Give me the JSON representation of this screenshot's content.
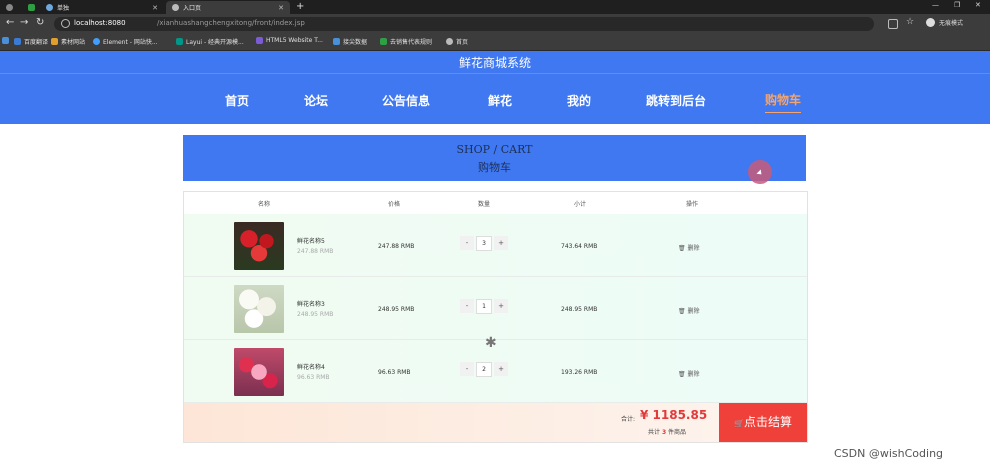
{
  "browser": {
    "tabs": [
      {
        "title": "",
        "color": "#2ea043"
      },
      {
        "title": "单独",
        "color": "#6fa8dc"
      },
      {
        "title": "入口页",
        "color": "#bbbbbb"
      }
    ],
    "url_host": "localhost:8080",
    "url_path": "/xianhuashangchengxitong/front/index.jsp",
    "profile_label": "无痕模式",
    "bookmarks": [
      {
        "label": "百度翻译",
        "color": "#3a7bd5"
      },
      {
        "label": "素材网站",
        "color": "#e0a030"
      },
      {
        "label": "Element - 网站快...",
        "color": "#409eff"
      },
      {
        "label": "Layui - 经典开源模...",
        "color": "#009688"
      },
      {
        "label": "HTML5 Website T...",
        "color": "#7b5cd6"
      },
      {
        "label": "接尖数据",
        "color": "#4a90d9"
      },
      {
        "label": "去销售代表规则",
        "color": "#2ea043"
      },
      {
        "label": "首页",
        "color": "#bbbbbb"
      }
    ]
  },
  "site": {
    "title": "鲜花商城系统",
    "nav": [
      "首页",
      "论坛",
      "公告信息",
      "鲜花",
      "我的",
      "跳转到后台",
      "购物车"
    ],
    "active_nav": "购物车"
  },
  "banner": {
    "en": "SHOP / CART",
    "cn": "购物车"
  },
  "table": {
    "headers": [
      "名称",
      "价格",
      "数量",
      "小计",
      "操作"
    ],
    "rows": [
      {
        "name": "鲜花名称5",
        "sub_price": "247.88 RMB",
        "price": "247.88 RMB",
        "qty": "3",
        "subtotal": "743.64 RMB",
        "delete_label": "删除",
        "image": "red-roses-bouquet"
      },
      {
        "name": "鲜花名称3",
        "sub_price": "248.95 RMB",
        "price": "248.95 RMB",
        "qty": "1",
        "subtotal": "248.95 RMB",
        "delete_label": "删除",
        "image": "white-flowers-bouquet"
      },
      {
        "name": "鲜花名称4",
        "sub_price": "96.63 RMB",
        "price": "96.63 RMB",
        "qty": "2",
        "subtotal": "193.26 RMB",
        "delete_label": "删除",
        "image": "pink-flowers-bouquet"
      }
    ],
    "minus": "-",
    "plus": "+"
  },
  "footer": {
    "total_label": "合计:",
    "total_amount": "¥ 1185.85",
    "count_prefix": "共计",
    "count": "3",
    "count_suffix": "件商品",
    "checkout_label": "点击结算"
  },
  "watermark": "CSDN @wishCoding",
  "colors": {
    "header": "#3f78f0",
    "active_nav": "#f4a46c",
    "price_red": "#e23a3a",
    "checkout": "#f0403a"
  }
}
